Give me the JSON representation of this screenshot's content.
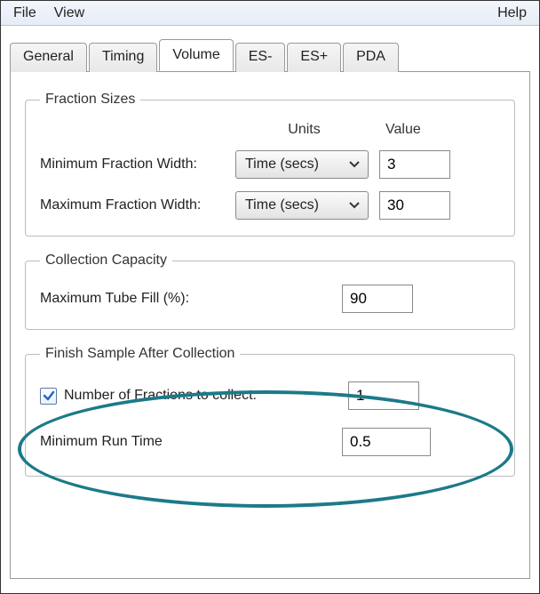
{
  "menubar": {
    "file": "File",
    "view": "View",
    "help": "Help"
  },
  "tabs": {
    "general": "General",
    "timing": "Timing",
    "volume": "Volume",
    "es_minus": "ES-",
    "es_plus": "ES+",
    "pda": "PDA"
  },
  "fraction_sizes": {
    "legend": "Fraction Sizes",
    "units_header": "Units",
    "value_header": "Value",
    "min_label": "Minimum Fraction Width:",
    "max_label": "Maximum Fraction Width:",
    "unit_selected": "Time (secs)",
    "min_value": "3",
    "max_value": "30"
  },
  "collection_capacity": {
    "legend": "Collection Capacity",
    "max_tube_fill_label": "Maximum Tube Fill (%):",
    "max_tube_fill_value": "90"
  },
  "finish_sample": {
    "legend": "Finish Sample After Collection",
    "num_fractions_label": "Number of Fractions to collect:",
    "num_fractions_value": "1",
    "min_run_time_label": "Minimum Run Time",
    "min_run_time_value": "0.5"
  }
}
